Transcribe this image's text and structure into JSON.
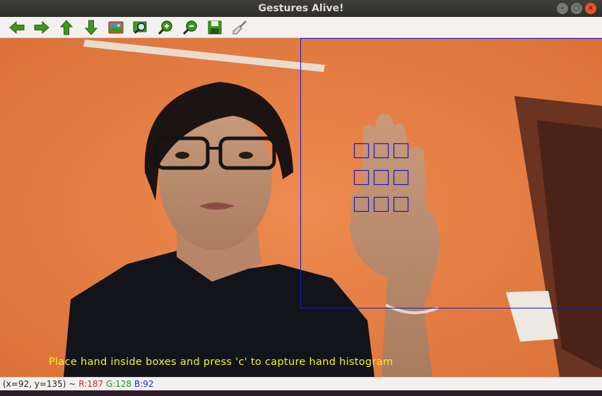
{
  "window": {
    "title": "Gestures Alive!",
    "controls": {
      "minimize": "–",
      "maximize": "□",
      "close": "×"
    }
  },
  "toolbar": {
    "buttons": [
      {
        "name": "pan-left",
        "icon": "arrow-left-icon"
      },
      {
        "name": "pan-right",
        "icon": "arrow-right-icon"
      },
      {
        "name": "pan-up",
        "icon": "arrow-up-icon"
      },
      {
        "name": "pan-down",
        "icon": "arrow-down-icon"
      },
      {
        "name": "zoom-fit",
        "icon": "image-icon"
      },
      {
        "name": "zoom-region",
        "icon": "zoom-rect-icon"
      },
      {
        "name": "zoom-in",
        "icon": "zoom-in-icon"
      },
      {
        "name": "zoom-out",
        "icon": "zoom-out-icon"
      },
      {
        "name": "save",
        "icon": "save-icon"
      },
      {
        "name": "properties",
        "icon": "brush-icon"
      }
    ]
  },
  "overlay": {
    "caption": "Place hand inside boxes and press 'c' to capture hand histogram",
    "caption_color": "#f7f12a",
    "box_color": "#1a1ac8"
  },
  "status": {
    "coords": "(x=92, y=135) ~",
    "r": "R:187",
    "g": "G:128",
    "b": "B:92"
  },
  "colors": {
    "wall": "#e47e45",
    "close_button": "#e95420",
    "toolbar_green": "#3b9a1c"
  }
}
